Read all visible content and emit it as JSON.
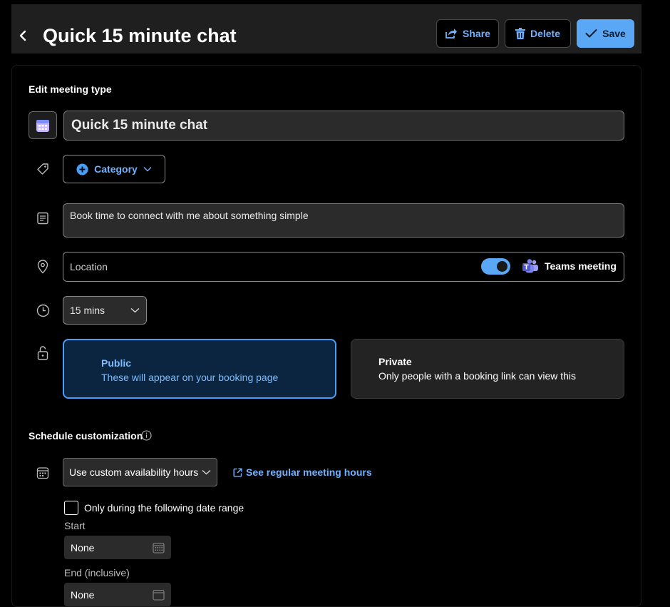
{
  "header": {
    "title": "Quick 15 minute chat",
    "share_label": "Share",
    "delete_label": "Delete",
    "save_label": "Save"
  },
  "form": {
    "section_title": "Edit meeting type",
    "name_value": "Quick 15 minute chat",
    "category_label": "Category",
    "description_value": "Book time to connect with me about something simple",
    "location_placeholder": "Location",
    "teams_toggle_on": true,
    "teams_label": "Teams meeting",
    "duration_value": "15 mins",
    "visibility": {
      "public_title": "Public",
      "public_desc": "These will appear on your booking page",
      "private_title": "Private",
      "private_desc": "Only people with a booking link can view this",
      "selected": "Public"
    }
  },
  "schedule": {
    "title": "Schedule customization",
    "availability_value": "Use custom availability hours",
    "see_hours_link": "See regular meeting hours",
    "date_range_label": "Only during the following date range",
    "date_range_checked": false,
    "start_label": "Start",
    "start_value": "None",
    "end_label": "End (inclusive)",
    "end_value": "None"
  },
  "colors": {
    "accent": "#5aa8f5",
    "link": "#6fb2ff",
    "public_card_bg": "#0b2540",
    "header_bg": "#1f1f1f"
  }
}
